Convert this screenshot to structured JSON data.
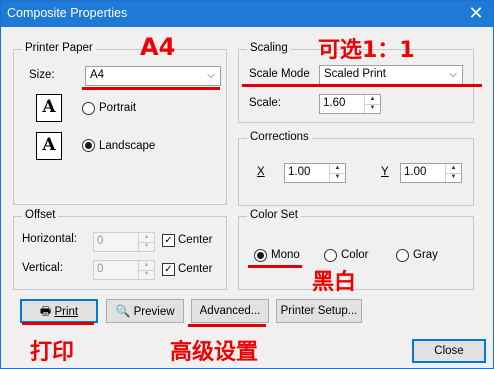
{
  "window": {
    "title": "Composite Properties",
    "close_glyph": "✕"
  },
  "printer_paper": {
    "group_label": "Printer Paper",
    "size_label": "Size:",
    "size_value": "A4",
    "portrait_label": "Portrait",
    "landscape_label": "Landscape",
    "orientation_selected": "Landscape",
    "icon_letter": "A"
  },
  "scaling": {
    "group_label": "Scaling",
    "mode_label": "Scale Mode",
    "mode_value": "Scaled Print",
    "scale_label": "Scale:",
    "scale_value": "1.60"
  },
  "corrections": {
    "group_label": "Corrections",
    "x_label": "X",
    "x_value": "1.00",
    "y_label": "Y",
    "y_value": "1.00"
  },
  "offset": {
    "group_label": "Offset",
    "horizontal_label": "Horizontal:",
    "horizontal_value": "0",
    "horizontal_center_label": "Center",
    "horizontal_center_checked": true,
    "vertical_label": "Vertical:",
    "vertical_value": "0",
    "vertical_center_label": "Center",
    "vertical_center_checked": true
  },
  "color_set": {
    "group_label": "Color Set",
    "options": [
      "Mono",
      "Color",
      "Gray"
    ],
    "selected": "Mono"
  },
  "buttons": {
    "print": "Print",
    "preview": "Preview",
    "advanced": "Advanced...",
    "printer_setup": "Printer Setup...",
    "close": "Close"
  },
  "annotations": {
    "a4": "A4",
    "optional": "可选1：1",
    "mono": "黑白",
    "print": "打印",
    "advanced": "高级设置",
    "color": "#ee0000"
  },
  "colors": {
    "titlebar": "#1e7ad6",
    "accent": "#0078d7"
  }
}
